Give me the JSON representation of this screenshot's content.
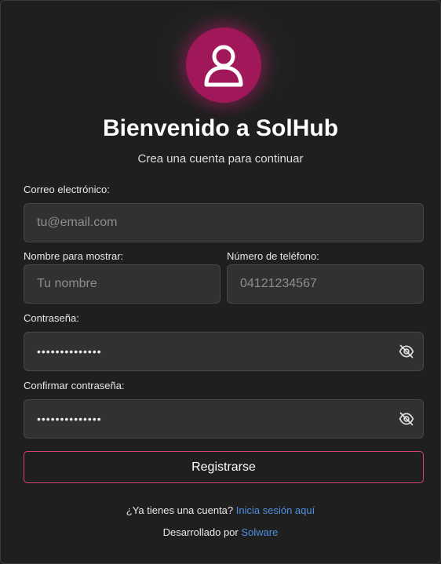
{
  "header": {
    "title": "Bienvenido a SolHub",
    "subtitle": "Crea una cuenta para continuar"
  },
  "form": {
    "email_label": "Correo electrónico:",
    "email_placeholder": "tu@email.com",
    "display_name_label": "Nombre para mostrar:",
    "display_name_placeholder": "Tu nombre",
    "phone_label": "Número de teléfono:",
    "phone_placeholder": "04121234567",
    "password_label": "Contraseña:",
    "password_value": "••••••••••••••",
    "confirm_label": "Confirmar contraseña:",
    "confirm_value": "••••••••••••••",
    "submit_label": "Registrarse"
  },
  "footer": {
    "login_prompt": "¿Ya tienes una cuenta?",
    "login_link": "Inicia sesión aquí",
    "credit_prefix": "Desarrollado por",
    "credit_link": "Solware"
  },
  "colors": {
    "accent": "#a0185a",
    "button_border": "#d8407f",
    "link": "#4d8fe0",
    "background": "#1f1f1f"
  },
  "icons": {
    "avatar": "user-icon",
    "password_toggle": "eye-off-icon"
  }
}
